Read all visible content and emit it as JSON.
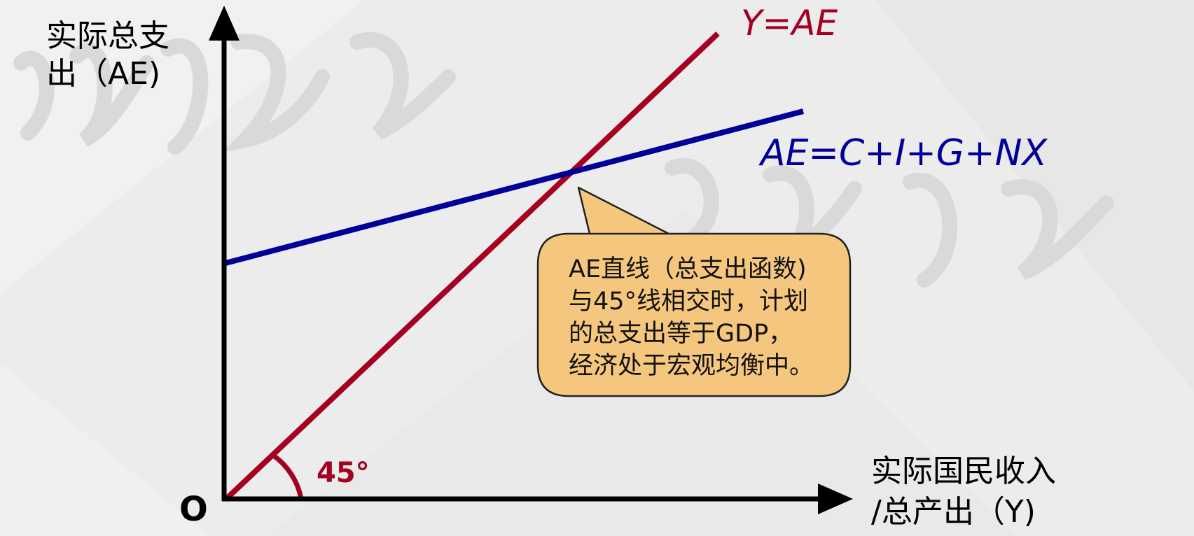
{
  "colors": {
    "background": "#ececec",
    "axis": "#000000",
    "line_45": "#a50021",
    "line_ae": "#000099",
    "callout_fill": "#f5c77e",
    "callout_border": "#222222",
    "watermark": "#d6d6d6"
  },
  "y_axis_label": {
    "line1": "实际总支",
    "line2": "出（AE)"
  },
  "x_axis_label": {
    "line1": "实际国民收入",
    "line2": "/总产出（Y)"
  },
  "origin_label": "O",
  "angle_label": "45°",
  "line_45_label": "Y=AE",
  "line_ae_label": "AE=C+I+G+NX",
  "callout": {
    "lines": [
      "AE直线（总支出函数)",
      "与45°线相交时，计划",
      "的总支出等于GDP，",
      "经济处于宏观均衡中。"
    ]
  }
}
